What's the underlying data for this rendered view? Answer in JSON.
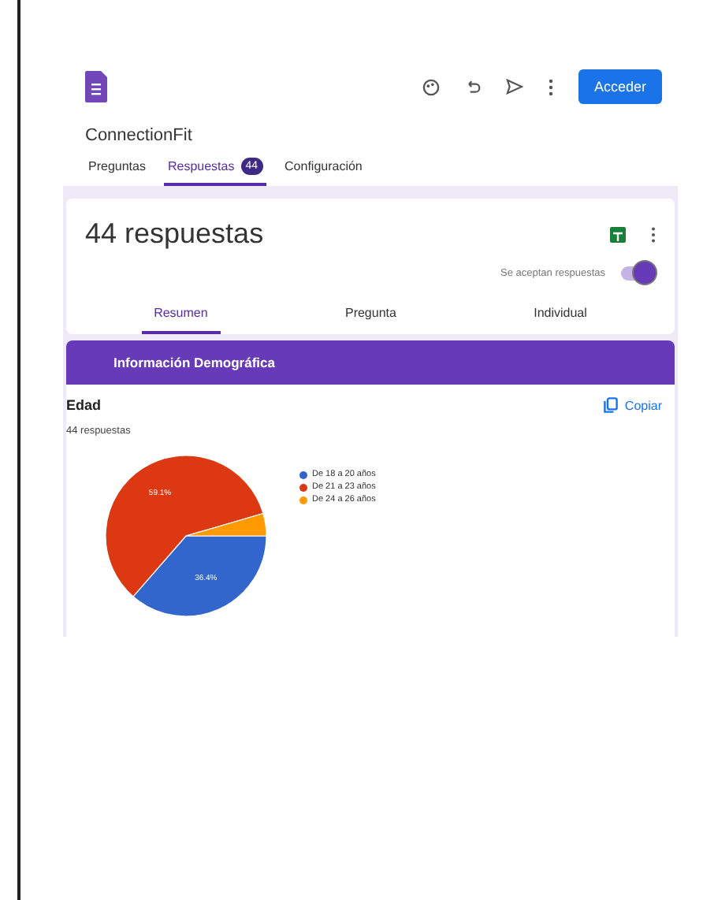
{
  "header": {
    "title": "ConnectionFit",
    "signin_button": "Acceder"
  },
  "tabs": [
    {
      "label": "Preguntas",
      "selected": false
    },
    {
      "label": "Respuestas",
      "badge": "44",
      "selected": true
    },
    {
      "label": "Configuración",
      "selected": false
    }
  ],
  "summary_card": {
    "title": "44 respuestas",
    "accepting_label": "Se aceptan respuestas",
    "accepting_on": true,
    "subtabs": [
      {
        "label": "Resumen",
        "selected": true
      },
      {
        "label": "Pregunta",
        "selected": false
      },
      {
        "label": "Individual",
        "selected": false
      }
    ]
  },
  "section": {
    "title": "Información Demográfica"
  },
  "question": {
    "title": "Edad",
    "count": "44 respuestas",
    "copy_button": "Copiar",
    "chart_data": {
      "type": "pie",
      "categories": [
        "De 18 a 20 años",
        "De 21 a 23 años",
        "De 24 a 26 años"
      ],
      "values": [
        36.4,
        59.1,
        4.5
      ],
      "colors": [
        "#3366cc",
        "#dc3912",
        "#ff9900"
      ],
      "value_labels": [
        "36.4%",
        "59.1%",
        null
      ]
    }
  }
}
